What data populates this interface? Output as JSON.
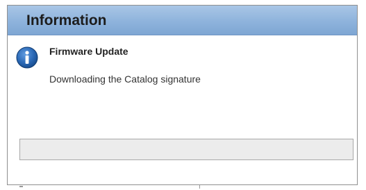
{
  "dialog": {
    "title": "Information",
    "heading": "Firmware Update",
    "message": "Downloading the Catalog signature",
    "icon": "info-icon",
    "progress": 0
  },
  "colors": {
    "title_bar": "#8eb3dc",
    "icon_blue": "#1f5fa8",
    "progress_track": "#ececec"
  }
}
